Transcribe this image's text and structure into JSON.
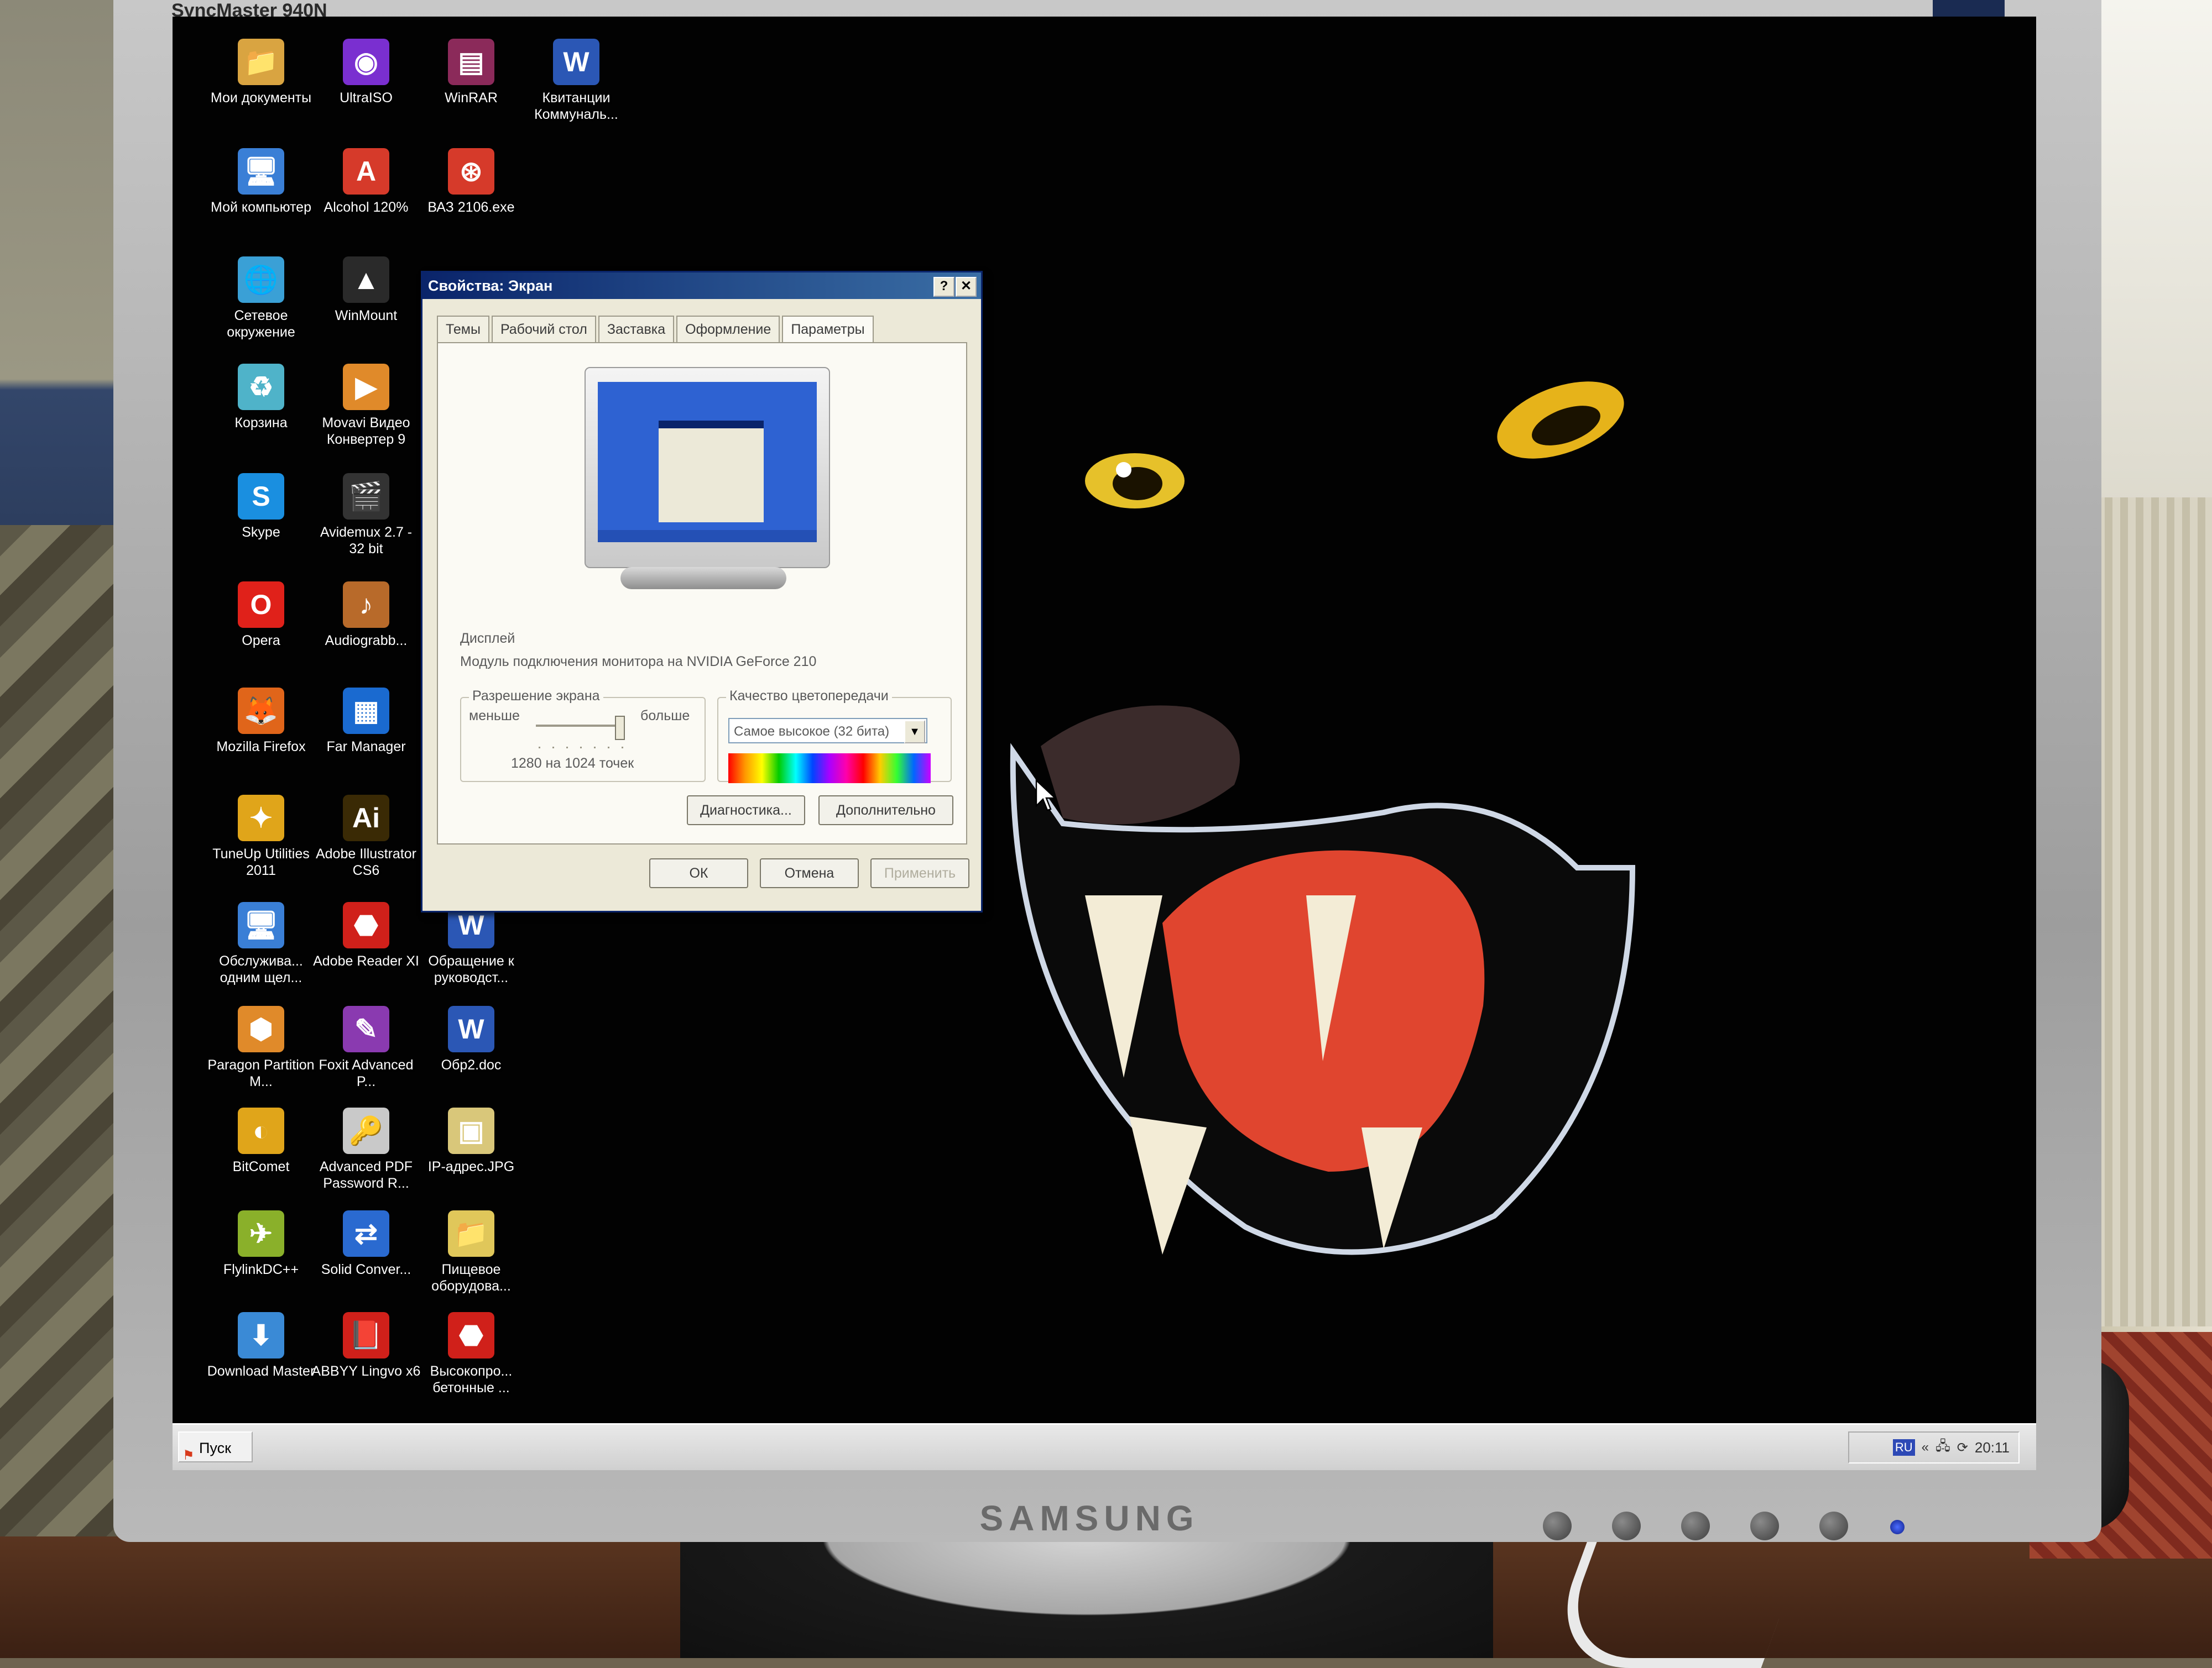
{
  "monitor": {
    "model_text": "SyncMaster 940N",
    "brand": "SAMSUNG"
  },
  "desktop": {
    "icons": [
      {
        "label": "Мои документы",
        "icon": "folder-documents-icon",
        "color": "#d9a441",
        "glyph": "📁"
      },
      {
        "label": "UltraISO",
        "icon": "ultraiso-icon",
        "color": "#7a2fd0",
        "glyph": "◉"
      },
      {
        "label": "WinRAR",
        "icon": "winrar-icon",
        "color": "#8b2a5a",
        "glyph": "▤"
      },
      {
        "label": "Квитанции Коммуналь...",
        "icon": "word-document-icon",
        "color": "#2b57b5",
        "glyph": "W"
      },
      {
        "label": "Мой компьютер",
        "icon": "my-computer-icon",
        "color": "#3a7fd6",
        "glyph": "🖥"
      },
      {
        "label": "Alcohol 120%",
        "icon": "alcohol-icon",
        "color": "#d63a2a",
        "glyph": "A"
      },
      {
        "label": "ВАЗ 2106.exe",
        "icon": "vaz-exe-icon",
        "color": "#d63a2a",
        "glyph": "⊛"
      },
      {
        "label": "Сетевое окружение",
        "icon": "network-icon",
        "color": "#3aa0d6",
        "glyph": "🌐"
      },
      {
        "label": "WinMount",
        "icon": "winmount-icon",
        "color": "#2a2a2a",
        "glyph": "▲"
      },
      {
        "label": "Корзина",
        "icon": "recycle-bin-icon",
        "color": "#4fb3c9",
        "glyph": "♻"
      },
      {
        "label": "Movavi Видео Конвертер 9",
        "icon": "movavi-icon",
        "color": "#e08a2a",
        "glyph": "▶"
      },
      {
        "label": "Skype",
        "icon": "skype-icon",
        "color": "#1a8fe0",
        "glyph": "S"
      },
      {
        "label": "Avidemux 2.7 - 32 bit",
        "icon": "avidemux-icon",
        "color": "#333333",
        "glyph": "🎬"
      },
      {
        "label": "Opera",
        "icon": "opera-icon",
        "color": "#e0211a",
        "glyph": "O"
      },
      {
        "label": "Audiograbb...",
        "icon": "audiograbber-icon",
        "color": "#b86a2a",
        "glyph": "♪"
      },
      {
        "label": "Mozilla Firefox",
        "icon": "firefox-icon",
        "color": "#e0651a",
        "glyph": "🦊"
      },
      {
        "label": "Far Manager",
        "icon": "far-manager-icon",
        "color": "#1a6ad0",
        "glyph": "▦"
      },
      {
        "label": "TuneUp Utilities 2011",
        "icon": "tuneup-icon",
        "color": "#e0a51a",
        "glyph": "✦"
      },
      {
        "label": "Adobe Illustrator CS6",
        "icon": "illustrator-icon",
        "color": "#3a2a05",
        "glyph": "Ai"
      },
      {
        "label": "Обслужива... одним щел...",
        "icon": "maintenance-icon",
        "color": "#3a7fd6",
        "glyph": "🖥"
      },
      {
        "label": "Adobe Reader XI",
        "icon": "adobe-reader-icon",
        "color": "#d0201a",
        "glyph": "⬣"
      },
      {
        "label": "Обращение к руководст...",
        "icon": "word-document-icon",
        "color": "#2b57b5",
        "glyph": "W"
      },
      {
        "label": "Paragon Partition M...",
        "icon": "paragon-icon",
        "color": "#e08a2a",
        "glyph": "⬢"
      },
      {
        "label": "Foxit Advanced P...",
        "icon": "foxit-icon",
        "color": "#8a3ab0",
        "glyph": "✎"
      },
      {
        "label": "Обр2.doc",
        "icon": "word-document-icon",
        "color": "#2b57b5",
        "glyph": "W"
      },
      {
        "label": "BitComet",
        "icon": "bitcomet-icon",
        "color": "#e0a51a",
        "glyph": "◐"
      },
      {
        "label": "Advanced PDF Password R...",
        "icon": "pdf-password-icon",
        "color": "#c9c9c9",
        "glyph": "🔑"
      },
      {
        "label": "IP-адрес.JPG",
        "icon": "jpg-file-icon",
        "color": "#d9c77a",
        "glyph": "▣"
      },
      {
        "label": "FlylinkDC++",
        "icon": "flylink-icon",
        "color": "#8ab02a",
        "glyph": "✈"
      },
      {
        "label": "Solid Conver...",
        "icon": "solid-converter-icon",
        "color": "#2a6ad0",
        "glyph": "⇄"
      },
      {
        "label": "Пищевое оборудова...",
        "icon": "folder-icon",
        "color": "#e0c75a",
        "glyph": "📁"
      },
      {
        "label": "Download Master",
        "icon": "download-master-icon",
        "color": "#3a8ad6",
        "glyph": "⬇"
      },
      {
        "label": "ABBYY Lingvo x6",
        "icon": "abbyy-lingvo-icon",
        "color": "#d0201a",
        "glyph": "📕"
      },
      {
        "label": "Высокопро... бетонные ...",
        "icon": "pdf-file-icon",
        "color": "#d0201a",
        "glyph": "⬣"
      }
    ]
  },
  "dialog": {
    "title": "Свойства: Экран",
    "help_button": "?",
    "close_button": "✕",
    "tabs": [
      "Темы",
      "Рабочий стол",
      "Заставка",
      "Оформление",
      "Параметры"
    ],
    "active_tab": "Параметры",
    "display_label": "Дисплей",
    "display_value": "Модуль подключения монитора на NVIDIA GeForce 210",
    "resolution": {
      "legend": "Разрешение экрана",
      "less_label": "меньше",
      "more_label": "больше",
      "value_text": "1280 на 1024 точек",
      "slider_fraction": 1.0
    },
    "color_quality": {
      "legend": "Качество цветопередачи",
      "selected": "Самое высокое (32 бита)"
    },
    "buttons": {
      "diagnostics": "Диагностика...",
      "advanced": "Дополнительно",
      "ok": "ОК",
      "cancel": "Отмена",
      "apply": "Применить"
    }
  },
  "taskbar": {
    "start_label": "Пуск",
    "tray_lang": "RU",
    "tray_chevron": "«",
    "clock": "20:11"
  }
}
